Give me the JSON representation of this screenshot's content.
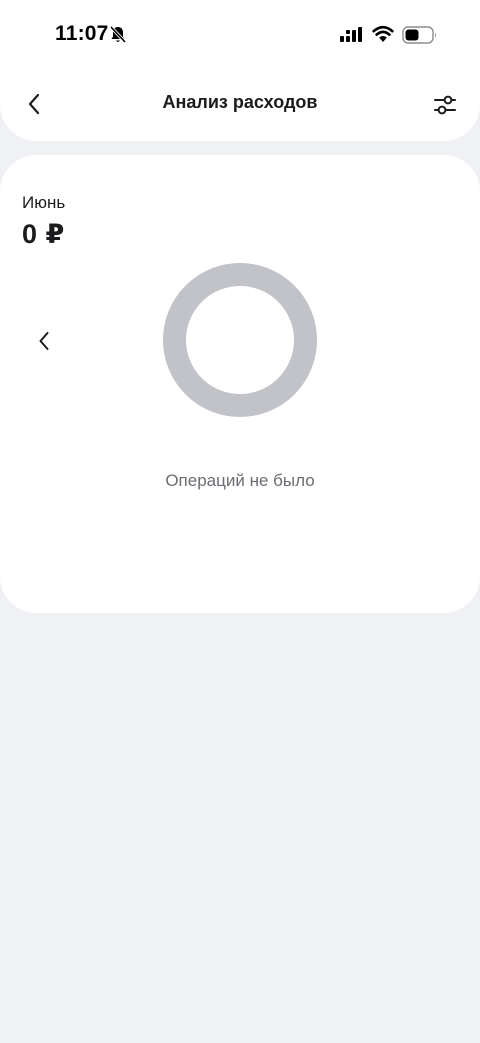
{
  "status_bar": {
    "time": "11:07"
  },
  "header": {
    "title": "Анализ расходов"
  },
  "summary": {
    "month": "Июнь",
    "amount": "0 ₽"
  },
  "chart": {
    "empty_message": "Операций не было",
    "ring_color": "#c1c3c9"
  },
  "icons": {
    "back": "chevron-left-icon",
    "filter": "sliders-icon",
    "prev": "chevron-left-icon",
    "bell": "bell-slash-icon",
    "signal": "cellular-signal-icon",
    "wifi": "wifi-icon",
    "battery": "battery-icon"
  }
}
